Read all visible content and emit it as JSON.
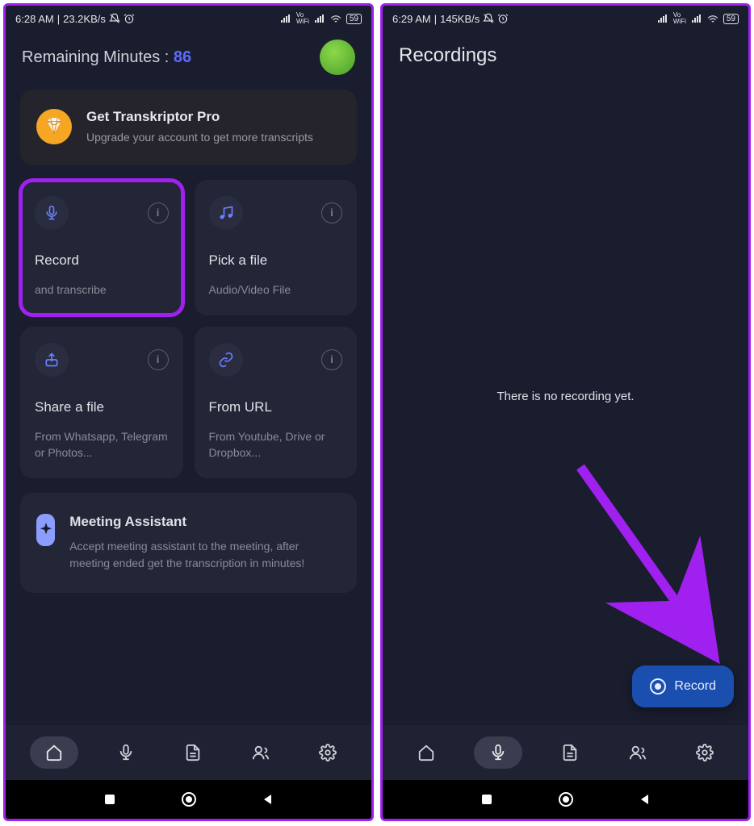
{
  "screen1": {
    "statusbar": {
      "time": "6:28 AM",
      "speed": "23.2KB/s",
      "battery": "59"
    },
    "remaining_label": "Remaining Minutes : ",
    "remaining_value": "86",
    "pro": {
      "title": "Get Transkriptor Pro",
      "subtitle": "Upgrade your account to get more transcripts"
    },
    "cards": {
      "record": {
        "title": "Record",
        "sub": "and transcribe"
      },
      "pick": {
        "title": "Pick a file",
        "sub": "Audio/Video File"
      },
      "share": {
        "title": "Share a file",
        "sub": "From Whatsapp, Telegram or Photos..."
      },
      "url": {
        "title": "From URL",
        "sub": "From Youtube, Drive or Dropbox..."
      }
    },
    "assistant": {
      "title": "Meeting Assistant",
      "sub": "Accept meeting assistant to the meeting, after meeting ended get the transcription in minutes!"
    }
  },
  "screen2": {
    "statusbar": {
      "time": "6:29 AM",
      "speed": "145KB/s",
      "battery": "59"
    },
    "title": "Recordings",
    "empty": "There is no recording yet.",
    "fab": "Record"
  }
}
